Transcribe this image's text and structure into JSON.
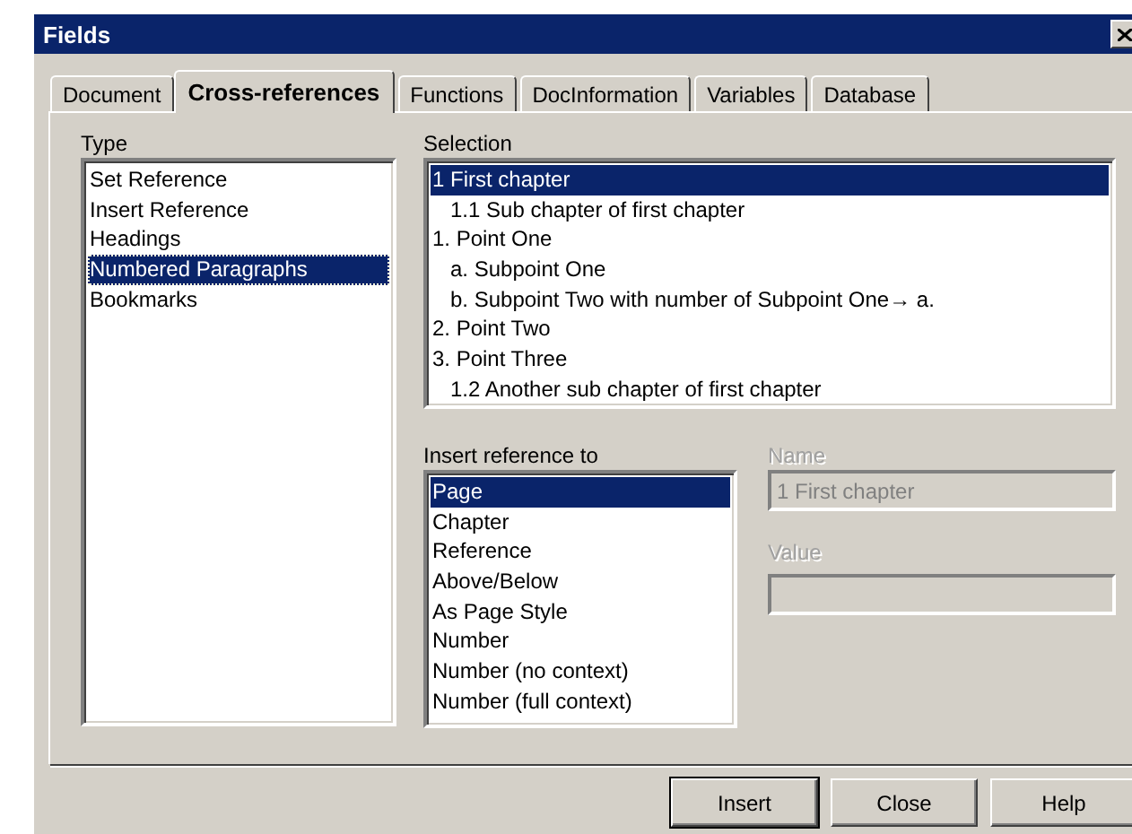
{
  "window": {
    "title": "Fields"
  },
  "tabs": [
    {
      "label": "Document",
      "selected": false
    },
    {
      "label": "Cross-references",
      "selected": true
    },
    {
      "label": "Functions",
      "selected": false
    },
    {
      "label": "DocInformation",
      "selected": false
    },
    {
      "label": "Variables",
      "selected": false
    },
    {
      "label": "Database",
      "selected": false
    }
  ],
  "type": {
    "label": "Type",
    "items": [
      {
        "label": "Set Reference",
        "selected": false
      },
      {
        "label": "Insert Reference",
        "selected": false
      },
      {
        "label": "Headings",
        "selected": false
      },
      {
        "label": "Numbered Paragraphs",
        "selected": true
      },
      {
        "label": "Bookmarks",
        "selected": false
      }
    ]
  },
  "selection": {
    "label": "Selection",
    "items": [
      {
        "label": "1 First chapter",
        "selected": true,
        "children": [
          {
            "label": "1.1 Sub chapter of first chapter",
            "selected": false
          }
        ]
      },
      {
        "label": "1. Point One",
        "selected": false,
        "children": [
          {
            "label": "a. Subpoint One",
            "selected": false
          },
          {
            "label": "b. Subpoint Two with number of Subpoint One→ a.",
            "selected": false
          }
        ]
      },
      {
        "label": "2. Point Two",
        "selected": false
      },
      {
        "label": "3. Point Three",
        "selected": false,
        "children": [
          {
            "label": "1.2 Another sub chapter of first chapter",
            "selected": false
          }
        ]
      }
    ]
  },
  "insert_reference": {
    "label": "Insert reference to",
    "items": [
      {
        "label": "Page",
        "selected": true
      },
      {
        "label": "Chapter",
        "selected": false
      },
      {
        "label": "Reference",
        "selected": false
      },
      {
        "label": "Above/Below",
        "selected": false
      },
      {
        "label": "As Page Style",
        "selected": false
      },
      {
        "label": "Number",
        "selected": false
      },
      {
        "label": "Number (no context)",
        "selected": false
      },
      {
        "label": "Number (full context)",
        "selected": false
      }
    ]
  },
  "name": {
    "label": "Name",
    "value": "1 First chapter",
    "disabled": true
  },
  "value": {
    "label": "Value",
    "disabled": true
  },
  "buttons": [
    {
      "label": "Insert",
      "default": true
    },
    {
      "label": "Close",
      "default": false
    },
    {
      "label": "Help",
      "default": false
    }
  ]
}
